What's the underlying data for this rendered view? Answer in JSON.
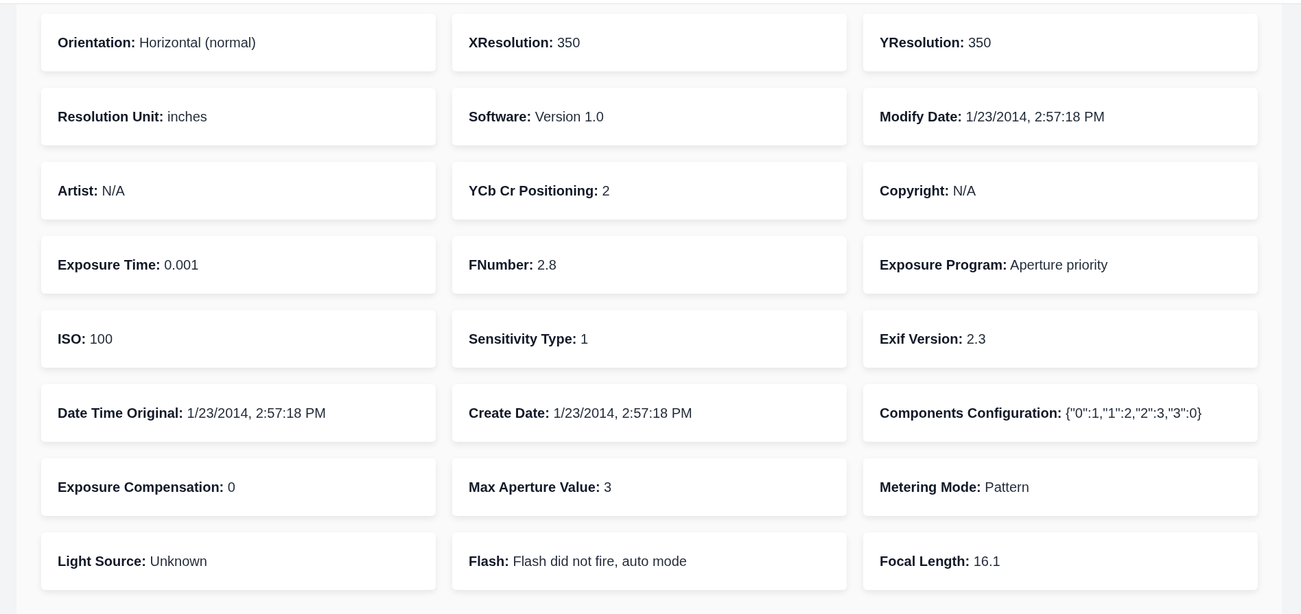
{
  "fields": [
    {
      "label": "Orientation:",
      "value": "Horizontal (normal)"
    },
    {
      "label": "XResolution:",
      "value": "350"
    },
    {
      "label": "YResolution:",
      "value": "350"
    },
    {
      "label": "Resolution Unit:",
      "value": "inches"
    },
    {
      "label": "Software:",
      "value": "Version 1.0"
    },
    {
      "label": "Modify Date:",
      "value": "1/23/2014, 2:57:18 PM"
    },
    {
      "label": "Artist:",
      "value": "N/A"
    },
    {
      "label": "YCb Cr Positioning:",
      "value": "2"
    },
    {
      "label": "Copyright:",
      "value": "N/A"
    },
    {
      "label": "Exposure Time:",
      "value": "0.001"
    },
    {
      "label": "FNumber:",
      "value": "2.8"
    },
    {
      "label": "Exposure Program:",
      "value": "Aperture priority"
    },
    {
      "label": "ISO:",
      "value": "100"
    },
    {
      "label": "Sensitivity Type:",
      "value": "1"
    },
    {
      "label": "Exif Version:",
      "value": "2.3"
    },
    {
      "label": "Date Time Original:",
      "value": "1/23/2014, 2:57:18 PM"
    },
    {
      "label": "Create Date:",
      "value": "1/23/2014, 2:57:18 PM"
    },
    {
      "label": "Components Configuration:",
      "value": "{\"0\":1,\"1\":2,\"2\":3,\"3\":0}"
    },
    {
      "label": "Exposure Compensation:",
      "value": "0"
    },
    {
      "label": "Max Aperture Value:",
      "value": "3"
    },
    {
      "label": "Metering Mode:",
      "value": "Pattern"
    },
    {
      "label": "Light Source:",
      "value": "Unknown"
    },
    {
      "label": "Flash:",
      "value": "Flash did not fire, auto mode"
    },
    {
      "label": "Focal Length:",
      "value": "16.1"
    }
  ]
}
